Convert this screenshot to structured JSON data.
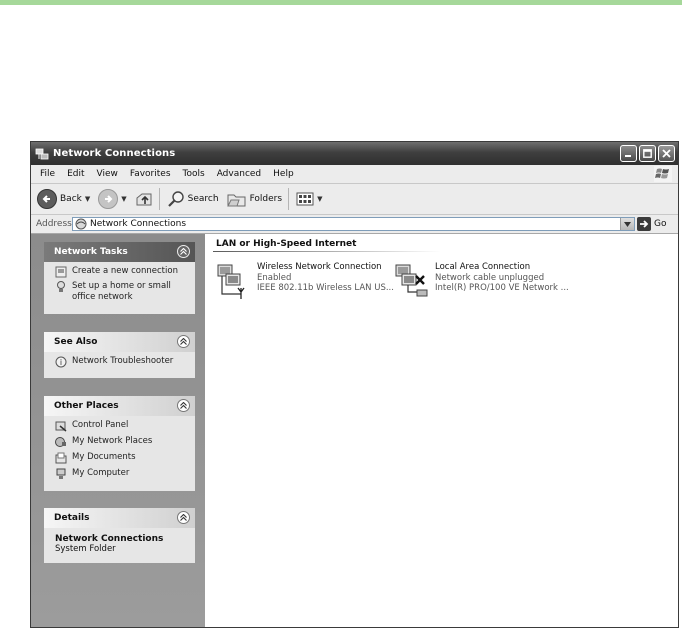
{
  "window": {
    "title": "Network Connections"
  },
  "menu": [
    "File",
    "Edit",
    "View",
    "Favorites",
    "Tools",
    "Advanced",
    "Help"
  ],
  "toolbar": {
    "back_label": "Back",
    "search_label": "Search",
    "folders_label": "Folders"
  },
  "address": {
    "label": "Address",
    "value": "Network Connections",
    "go_label": "Go"
  },
  "sidebar": {
    "network_tasks": {
      "title": "Network Tasks",
      "items": [
        {
          "label": "Create a new connection",
          "icon": "new-connection-icon"
        },
        {
          "label": "Set up a home or small office network",
          "icon": "home-network-icon"
        }
      ]
    },
    "see_also": {
      "title": "See Also",
      "items": [
        {
          "label": "Network Troubleshooter",
          "icon": "help-icon"
        }
      ]
    },
    "other_places": {
      "title": "Other Places",
      "items": [
        {
          "label": "Control Panel",
          "icon": "control-panel-icon"
        },
        {
          "label": "My Network Places",
          "icon": "network-places-icon"
        },
        {
          "label": "My Documents",
          "icon": "documents-folder-icon"
        },
        {
          "label": "My Computer",
          "icon": "computer-icon"
        }
      ]
    },
    "details": {
      "title": "Details",
      "name": "Network Connections",
      "type": "System Folder"
    }
  },
  "content": {
    "group_header": "LAN or High-Speed Internet",
    "connections": [
      {
        "name": "Wireless Network Connection",
        "status": "Enabled",
        "device": "IEEE 802.11b Wireless LAN US...",
        "icon": "wireless-connection-icon"
      },
      {
        "name": "Local Area Connection",
        "status": "Network cable unplugged",
        "device": "Intel(R) PRO/100 VE Network ...",
        "icon": "lan-unplugged-icon"
      }
    ]
  },
  "colors": {
    "top_strip": "#a6d89a",
    "title_bar": "#3f3f3f",
    "task_pane": "#8c8c8c"
  }
}
